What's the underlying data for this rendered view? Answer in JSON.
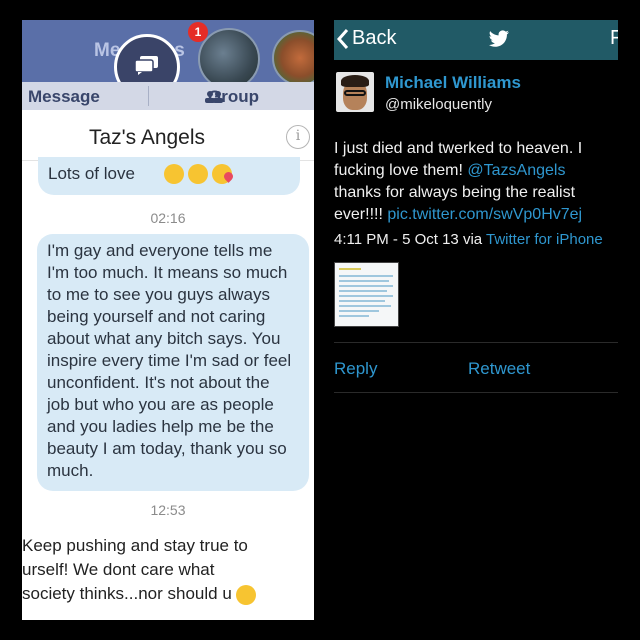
{
  "messenger": {
    "header_title": "Messages",
    "badge_count": "1",
    "tabs": [
      "Message",
      "Group"
    ],
    "conversation_title": "Taz's Angels",
    "messages": [
      {
        "text": "Lots of love",
        "emojis": [
          "kissing-face",
          "kissing-face",
          "face-blowing-kiss"
        ]
      },
      {
        "timestamp": "02:16"
      },
      {
        "text": "I'm gay and everyone tells me\nI'm too much. It means so much\nto me to see you guys always\nbeing yourself and not caring\nabout what any bitch says. You\ninspire every time I'm sad or feel\nunconfident. It's not about the\njob but who you are as people\nand you ladies help me be the\nbeauty I am today, thank you so\nmuch."
      },
      {
        "timestamp": "12:53"
      },
      {
        "text": "Keep pushing and stay true to\nurself! We dont care what\nsociety thinks...nor should u",
        "emojis": [
          "smiling-face"
        ]
      }
    ]
  },
  "twitter": {
    "back_label": "Back",
    "cut_label": "F",
    "author_name": "Michael Williams",
    "author_handle": "@mikeloquently",
    "tweet_lines": [
      "I just died and twerked to heaven. I",
      "fucking love them! "
    ],
    "mention": "@TazsAngels",
    "line3": "thanks for always being the realist",
    "line4_prefix": "ever!!!! ",
    "pic_link": "pic.twitter.com/swVp0Hv7ej",
    "timestamp": "4:11 PM - 5 Oct 13 via ",
    "via": "Twitter for iPhone",
    "reply_label": "Reply",
    "retweet_label": "Retweet"
  },
  "colors": {
    "fb_blue": "#5a6fa8",
    "bubble": "#d8eaf6",
    "twitter_bar": "#215a66",
    "twitter_link": "#2f97cf"
  }
}
